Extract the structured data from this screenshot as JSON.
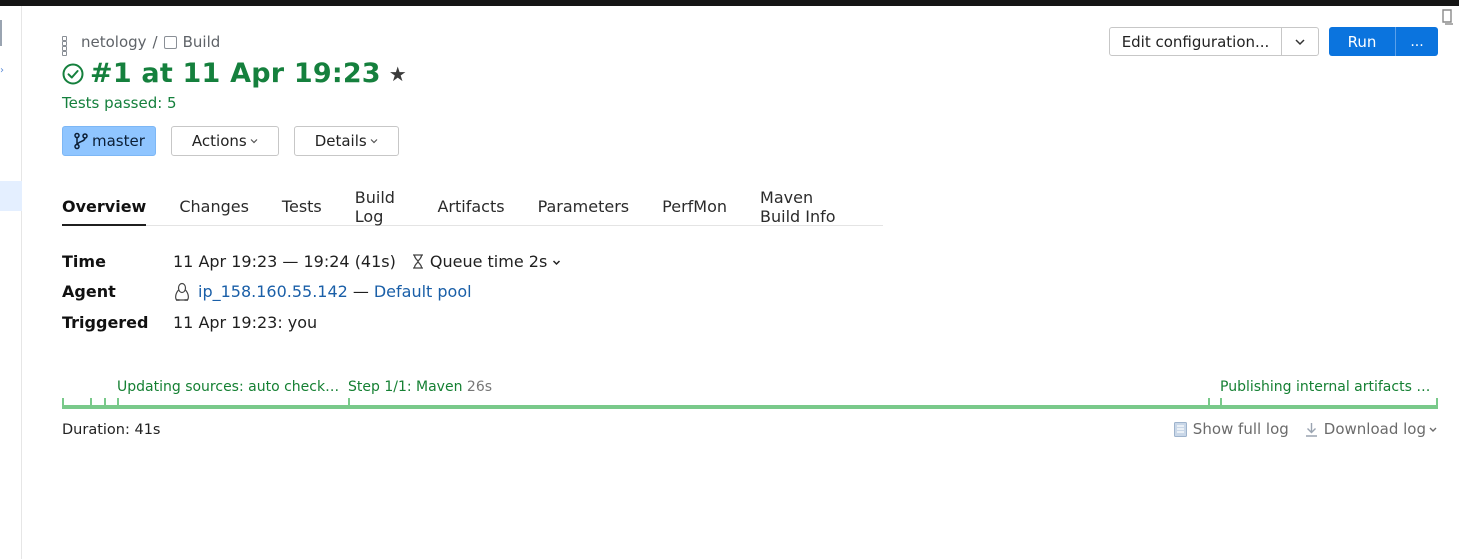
{
  "breadcrumb": {
    "project": "netology",
    "separator": "/",
    "build_config": "Build"
  },
  "build": {
    "title": "#1 at 11 Apr 19:23",
    "status_text": "Tests passed: 5"
  },
  "chips": {
    "branch": "master",
    "actions": "Actions",
    "details": "Details"
  },
  "toolbar": {
    "edit_configuration": "Edit configuration...",
    "run": "Run",
    "more": "..."
  },
  "tabs": [
    "Overview",
    "Changes",
    "Tests",
    "Build Log",
    "Artifacts",
    "Parameters",
    "PerfMon",
    "Maven Build Info"
  ],
  "overview": {
    "time_label": "Time",
    "time_value": "11 Apr 19:23 — 19:24 (41s)",
    "queue_time": "Queue time 2s",
    "agent_label": "Agent",
    "agent_name": "ip_158.160.55.142",
    "agent_sep": "—",
    "agent_pool": "Default pool",
    "triggered_label": "Triggered",
    "triggered_value": "11 Apr 19:23: you"
  },
  "timeline": {
    "stage1": "Updating sources: auto check…",
    "stage2": "Step 1/1: Maven",
    "stage2_duration": "26s",
    "stage3": "Publishing internal artifacts …"
  },
  "footer": {
    "duration": "Duration: 41s",
    "show_full_log": "Show full log",
    "download_log": "Download log"
  },
  "colors": {
    "success": "#15803d",
    "accent": "#0b74de",
    "branch_chip": "#8fc5ff",
    "timeline": "#79c98a",
    "link": "#1a5fa8"
  }
}
